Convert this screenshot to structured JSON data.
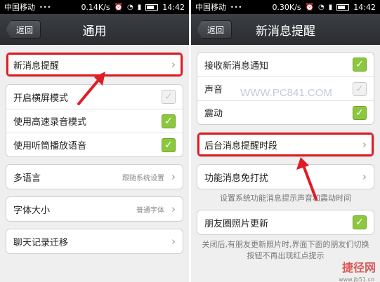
{
  "left": {
    "status": {
      "carrier": "中国移动",
      "dots": "•••",
      "speed": "0.14K/s",
      "time": "14:42"
    },
    "nav": {
      "back": "返回",
      "title": "通用"
    },
    "group1": [
      {
        "label": "新消息提醒"
      }
    ],
    "group2": [
      {
        "label": "开启横屏模式",
        "checked": false
      },
      {
        "label": "使用高速录音模式",
        "checked": true
      },
      {
        "label": "使用听筒播放语音",
        "checked": true
      }
    ],
    "language": {
      "label": "多语言",
      "value": "跟随系统设置"
    },
    "font": {
      "label": "字体大小",
      "value": "普通字体"
    },
    "migrate": {
      "label": "聊天记录迁移"
    }
  },
  "right": {
    "status": {
      "carrier": "中国移动",
      "dots": "•••",
      "speed": "0.30K/s",
      "time": "14:42"
    },
    "nav": {
      "back": "返回",
      "title": "新消息提醒"
    },
    "group1": [
      {
        "label": "接收新消息通知",
        "checked": true
      },
      {
        "label": "声音",
        "checked": false
      },
      {
        "label": "震动",
        "checked": true
      }
    ],
    "schedule": {
      "label": "后台消息提醒时段"
    },
    "dnd": {
      "label": "功能消息免打扰"
    },
    "dnd_note": "设置系统功能消息提示声音和震动时间",
    "moments": {
      "label": "朋友圈照片更新",
      "checked": true
    },
    "moments_note": "关闭后,有朋友更新照片时,界面下面的朋友们切换按钮不再出现红点提示"
  },
  "watermark": {
    "center": "WWW.PC841.COM",
    "logo": "捷径网",
    "site": "www.jb51.cn"
  },
  "colors": {
    "highlight": "#e01c24",
    "check": "#8dc73f"
  }
}
